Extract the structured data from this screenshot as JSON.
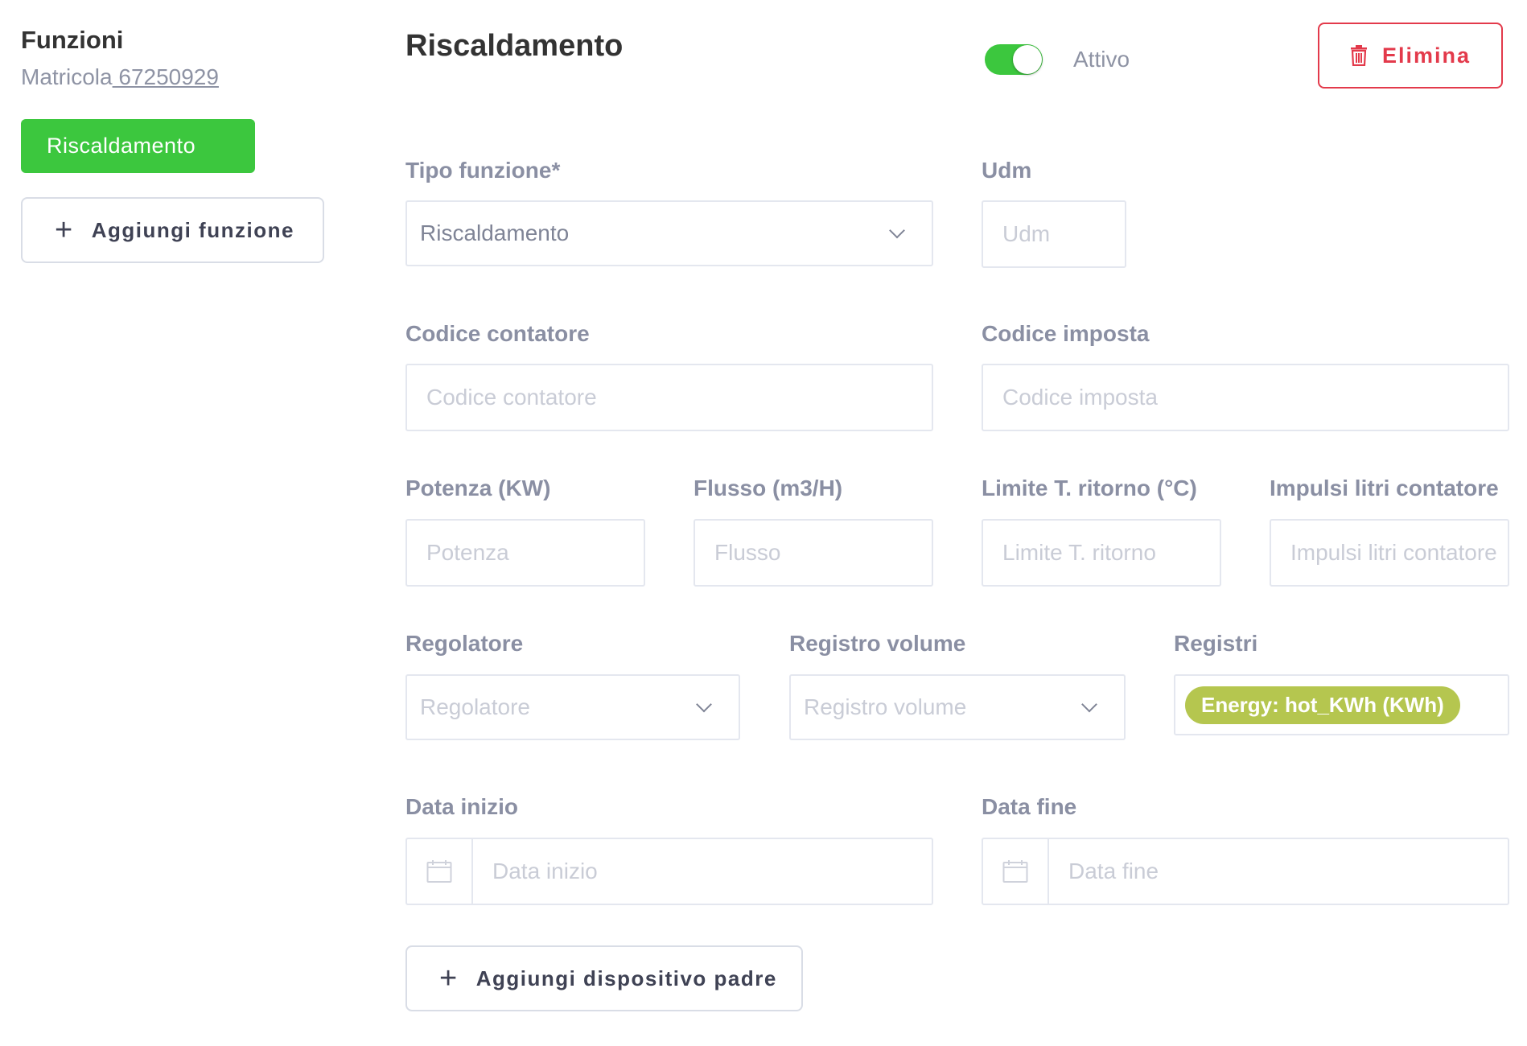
{
  "sidebar": {
    "title": "Funzioni",
    "serial_label": "Matricola",
    "serial_value": " 67250929",
    "active_item": "Riscaldamento",
    "add_button": "Aggiungi funzione"
  },
  "header": {
    "title": "Riscaldamento",
    "toggle_label": "Attivo",
    "toggle_on": true,
    "delete_button": "Elimina"
  },
  "form": {
    "tipo_funzione": {
      "label": "Tipo funzione*",
      "value": "Riscaldamento"
    },
    "udm": {
      "label": "Udm",
      "placeholder": "Udm"
    },
    "codice_contatore": {
      "label": "Codice contatore",
      "placeholder": "Codice contatore"
    },
    "codice_imposta": {
      "label": "Codice imposta",
      "placeholder": "Codice imposta"
    },
    "potenza": {
      "label": "Potenza (KW)",
      "placeholder": "Potenza"
    },
    "flusso": {
      "label": "Flusso (m3/H)",
      "placeholder": "Flusso"
    },
    "limite_ritorno": {
      "label": "Limite T. ritorno (°C)",
      "placeholder": "Limite T. ritorno"
    },
    "impulsi": {
      "label": "Impulsi litri contatore",
      "placeholder": "Impulsi litri contatore"
    },
    "regolatore": {
      "label": "Regolatore",
      "placeholder": "Regolatore"
    },
    "registro_volume": {
      "label": "Registro volume",
      "placeholder": "Registro volume"
    },
    "registri": {
      "label": "Registri",
      "tags": [
        "Energy: hot_KWh (KWh)"
      ]
    },
    "data_inizio": {
      "label": "Data inizio",
      "placeholder": "Data inizio"
    },
    "data_fine": {
      "label": "Data fine",
      "placeholder": "Data fine"
    }
  },
  "add_parent_button": "Aggiungi dispositivo padre",
  "colors": {
    "accent_green": "#3cc73e",
    "danger_red": "#e33a4b",
    "tag_olive": "#b5c64f"
  },
  "icons": [
    "plus-icon",
    "trash-icon",
    "chevron-down-icon",
    "calendar-icon"
  ]
}
